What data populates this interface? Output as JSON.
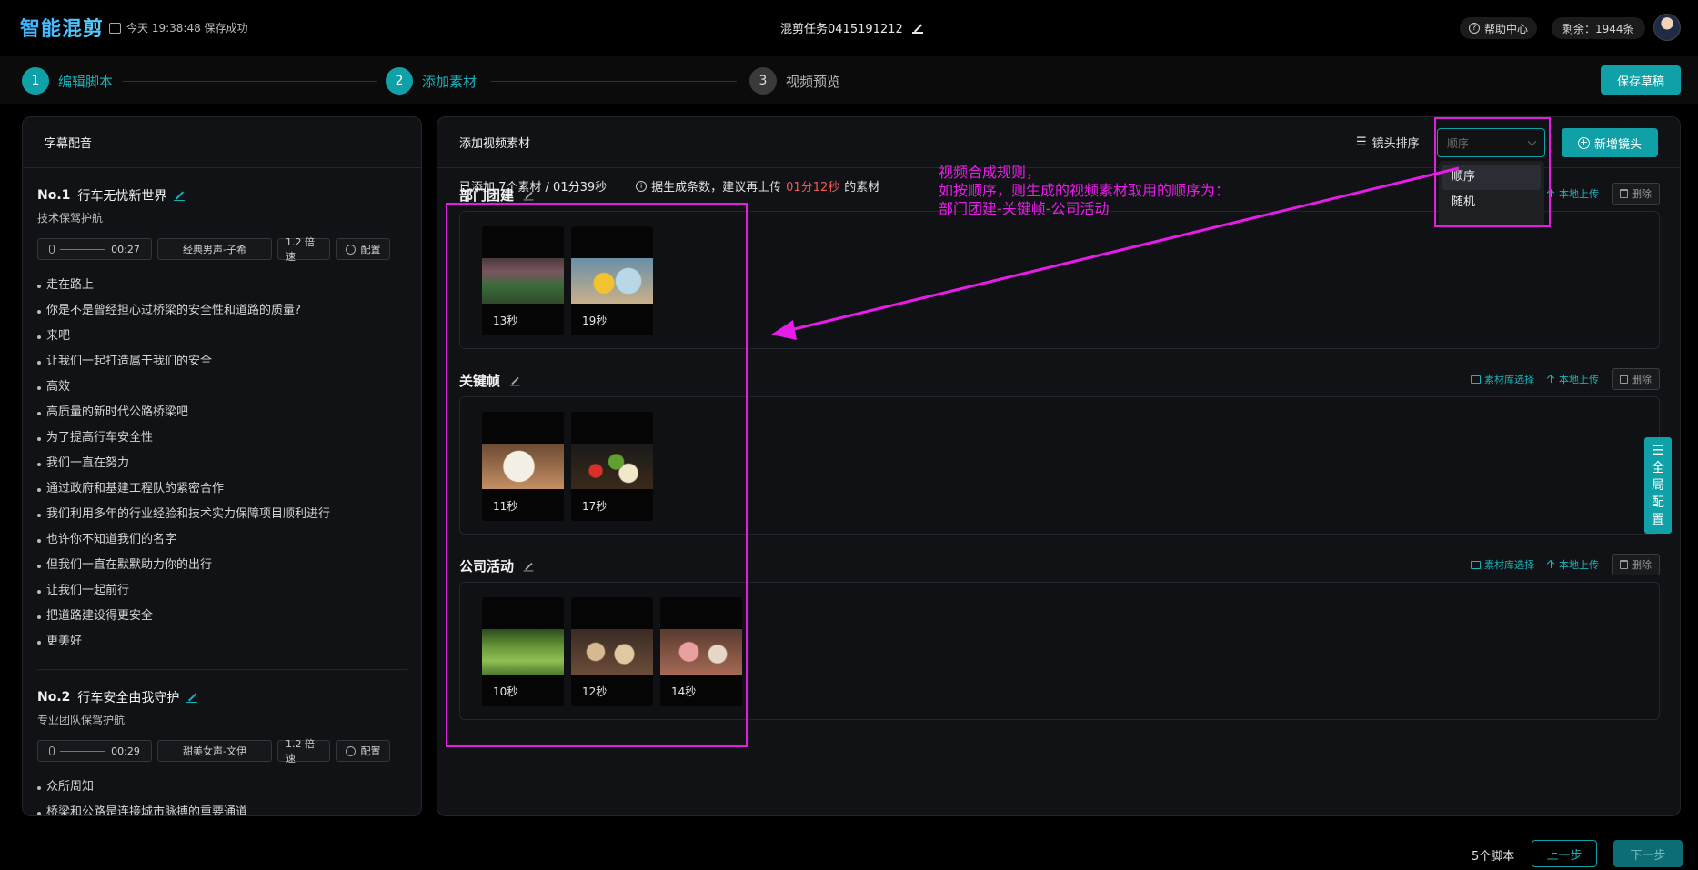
{
  "header": {
    "logo": "智能混剪",
    "save_status": "今天 19:38:48 保存成功",
    "task_title": "混剪任务0415191212",
    "help": "帮助中心",
    "balance": "剩余：1944条"
  },
  "steps": [
    {
      "num": "1",
      "label": "编辑脚本",
      "state": "done"
    },
    {
      "num": "2",
      "label": "添加素材",
      "state": "active"
    },
    {
      "num": "3",
      "label": "视频预览",
      "state": "todo"
    }
  ],
  "save_draft": "保存草稿",
  "left_panel": {
    "title": "字幕配音",
    "scripts": [
      {
        "no": "No.1",
        "title": "行车无忧新世界",
        "subtitle": "技术保驾护航",
        "duration": "00:27",
        "voice": "经典男声-子希",
        "speed": "1.2 倍速",
        "config": "配置",
        "lines": [
          "走在路上",
          "你是不是曾经担心过桥梁的安全性和道路的质量?",
          "来吧",
          "让我们一起打造属于我们的安全",
          "高效",
          "高质量的新时代公路桥梁吧",
          "为了提高行车安全性",
          "我们一直在努力",
          "通过政府和基建工程队的紧密合作",
          "我们利用多年的行业经验和技术实力保障项目顺利进行",
          "也许你不知道我们的名字",
          "但我们一直在默默助力你的出行",
          "让我们一起前行",
          "把道路建设得更安全",
          "更美好"
        ]
      },
      {
        "no": "No.2",
        "title": "行车安全由我守护",
        "subtitle": "专业团队保驾护航",
        "duration": "00:29",
        "voice": "甜美女声-文伊",
        "speed": "1.2 倍速",
        "config": "配置",
        "lines": [
          "众所周知",
          "桥梁和公路是连接城市脉搏的重要通道"
        ]
      }
    ]
  },
  "right_panel": {
    "title": "添加视频素材",
    "sort_label": "镜头排序",
    "sort_placeholder": "顺序",
    "sort_options": [
      "顺序",
      "随机"
    ],
    "add_shot": "新增镜头",
    "summary": "已添加 7个素材 / 01分39秒",
    "hint_prefix": "据生成条数，建议再上传",
    "hint_time": "01分12秒",
    "hint_suffix": "的素材",
    "actions": {
      "library": "素材库选择",
      "upload": "本地上传",
      "delete": "删除"
    },
    "groups": [
      {
        "name": "部门团建",
        "clips": [
          {
            "dur": "13秒",
            "img": "market"
          },
          {
            "dur": "19秒",
            "img": "food1"
          }
        ]
      },
      {
        "name": "关键帧",
        "clips": [
          {
            "dur": "11秒",
            "img": "plate1"
          },
          {
            "dur": "17秒",
            "img": "veg"
          }
        ]
      },
      {
        "name": "公司活动",
        "clips": [
          {
            "dur": "10秒",
            "img": "field"
          },
          {
            "dur": "12秒",
            "img": "tray"
          },
          {
            "dur": "14秒",
            "img": "cook"
          }
        ]
      }
    ],
    "float_tab": "全局配置"
  },
  "annotation": {
    "line1": "视频合成规则，",
    "line2": "如按顺序，则生成的视频素材取用的顺序为：",
    "line3": "部门团建-关键帧-公司活动",
    "color": "#e81ce8"
  },
  "footer": {
    "count": "5个脚本",
    "prev": "上一步",
    "next": "下一步"
  },
  "colors": {
    "accent": "#0fa0a8",
    "warning": "#f05a5a",
    "annotation": "#e01ee0"
  }
}
